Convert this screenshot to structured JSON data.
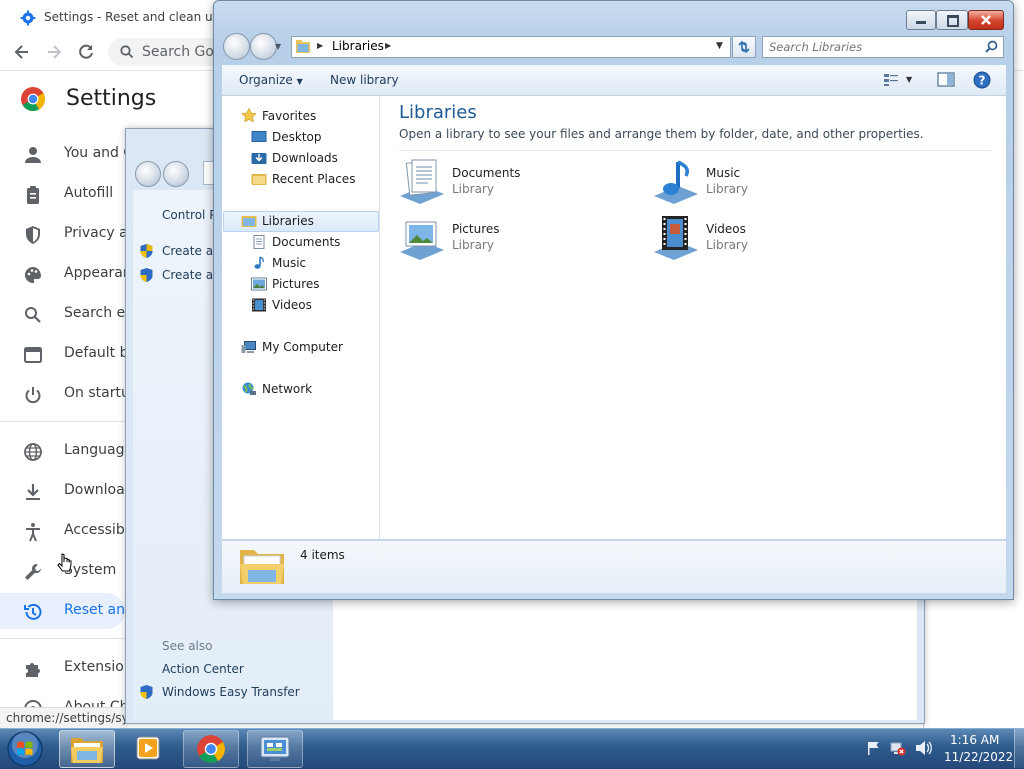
{
  "chrome": {
    "tab_title": "Settings - Reset and clean up",
    "search_placeholder": "Search Goo",
    "settings_title": "Settings",
    "nav": [
      {
        "label": "You and G"
      },
      {
        "label": "Autofill"
      },
      {
        "label": "Privacy ar"
      },
      {
        "label": "Appearan"
      },
      {
        "label": "Search en"
      },
      {
        "label": "Default br"
      },
      {
        "label": "On startup"
      },
      {
        "label": "Language"
      },
      {
        "label": "Download"
      },
      {
        "label": "Accessibi"
      },
      {
        "label": "System"
      },
      {
        "label": "Reset and"
      },
      {
        "label": "Extension"
      },
      {
        "label": "About Ch"
      }
    ],
    "status_url": "chrome://settings/syste",
    "active_color": "#1a73e8"
  },
  "control_panel": {
    "breadcrumb": "Control P",
    "tasks": [
      {
        "label": "Create a s"
      },
      {
        "label": "Create a s"
      }
    ],
    "see_also_heading": "See also",
    "see_also": [
      {
        "label": "Action Center"
      },
      {
        "label": "Windows Easy Transfer"
      }
    ]
  },
  "explorer": {
    "address": [
      "Libraries"
    ],
    "search_placeholder": "Search Libraries",
    "commands": {
      "organize": "Organize",
      "new_library": "New library"
    },
    "nav_pane": {
      "favorites": "Favorites",
      "favorites_items": [
        "Desktop",
        "Downloads",
        "Recent Places"
      ],
      "libraries": "Libraries",
      "libraries_items": [
        "Documents",
        "Music",
        "Pictures",
        "Videos"
      ],
      "computer": "My Computer",
      "network": "Network"
    },
    "heading": "Libraries",
    "description": "Open a library to see your files and arrange them by folder, date, and other properties.",
    "libraries": [
      {
        "name": "Documents",
        "type": "Library"
      },
      {
        "name": "Music",
        "type": "Library"
      },
      {
        "name": "Pictures",
        "type": "Library"
      },
      {
        "name": "Videos",
        "type": "Library"
      }
    ],
    "details": {
      "item_count": "4 items"
    }
  },
  "taskbar": {
    "time": "1:16 AM",
    "date": "11/22/2022"
  }
}
